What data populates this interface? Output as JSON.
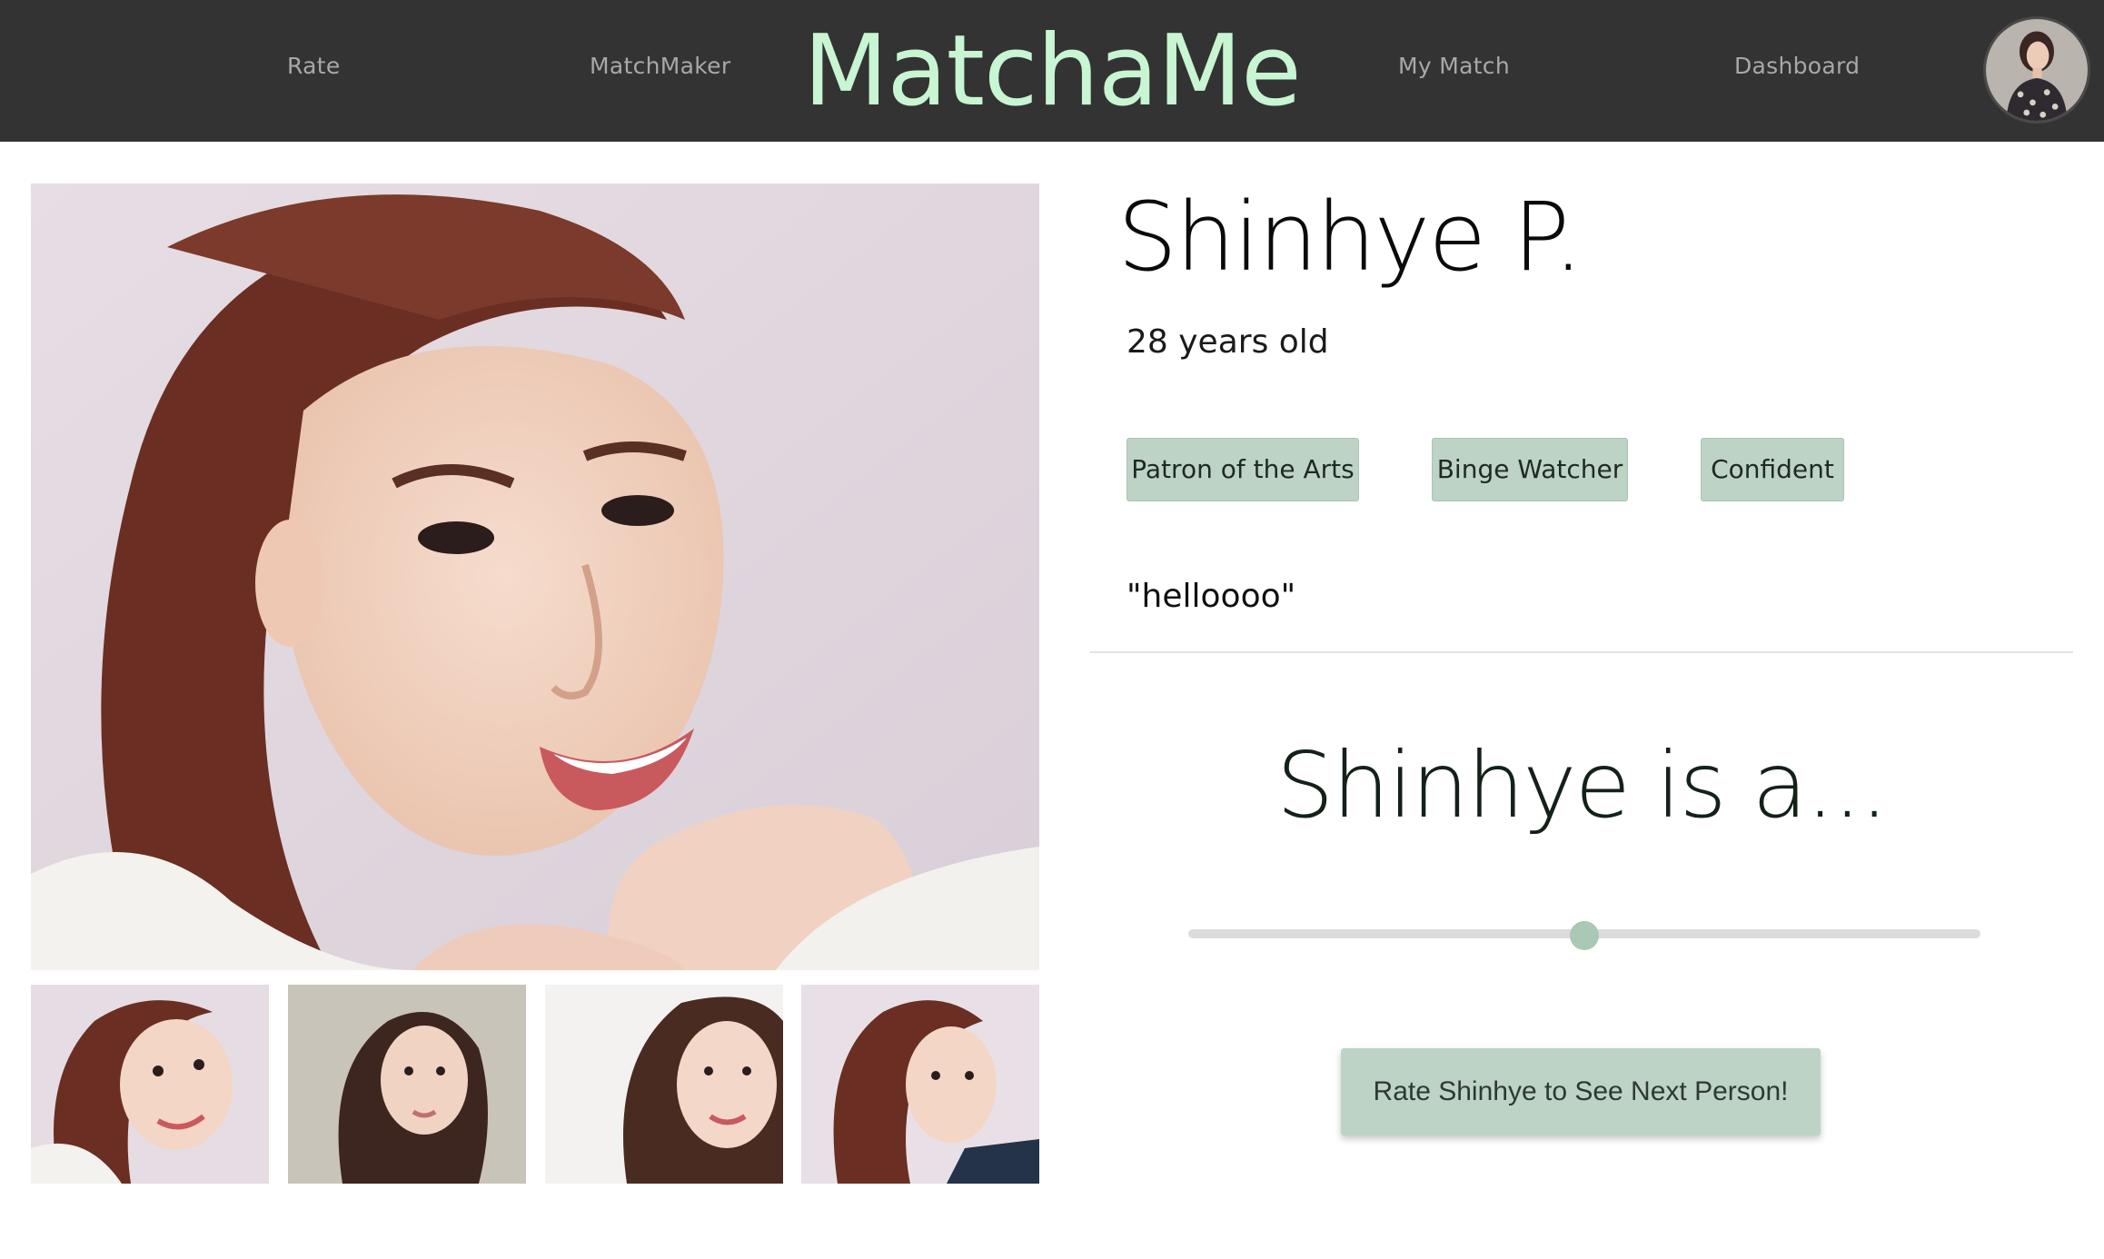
{
  "nav": {
    "items": [
      {
        "label": "Rate"
      },
      {
        "label": "MatchMaker"
      },
      {
        "label": "My Match"
      },
      {
        "label": "Dashboard"
      }
    ],
    "brand": "MatchaMe",
    "avatar_icon": "user-avatar-photo"
  },
  "profile": {
    "name": "Shinhye P.",
    "age": "28 years old",
    "tags": [
      {
        "label": "Patron of the Arts"
      },
      {
        "label": "Binge Watcher"
      },
      {
        "label": "Confident"
      }
    ],
    "quote": "\"helloooo\""
  },
  "photos": {
    "main_icon": "main-profile-photo",
    "thumbnail_count": 4
  },
  "rating": {
    "heading": "Shinhye is a...",
    "slider_value": 0.5,
    "button_label": "Rate Shinhye to See Next Person!"
  },
  "colors": {
    "nav_background": "#333333",
    "brand": "#c8f5d2",
    "accent": "#bdd3c6",
    "slider_thumb": "#a9c8b6"
  }
}
